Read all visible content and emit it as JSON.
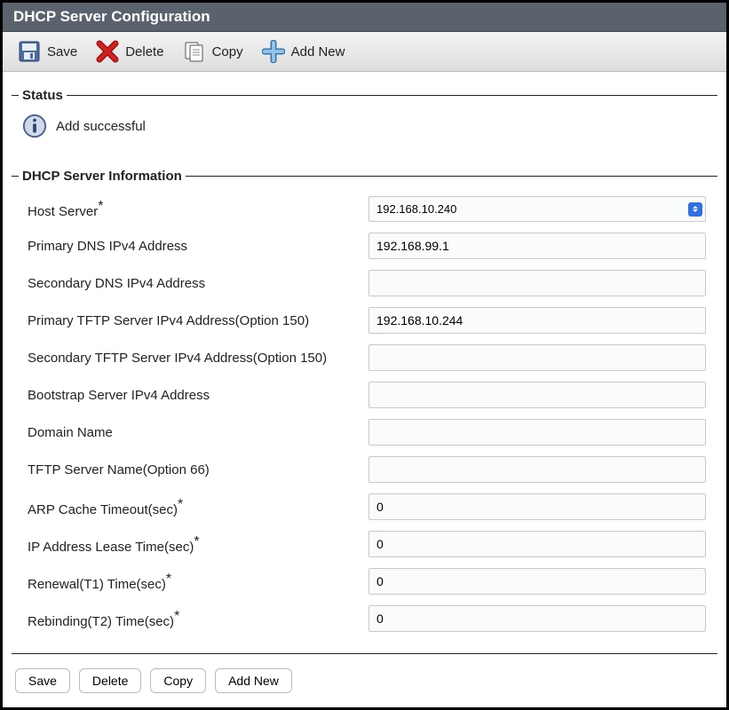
{
  "title": "DHCP Server Configuration",
  "toolbar": {
    "save": "Save",
    "delete": "Delete",
    "copy": "Copy",
    "addnew": "Add New"
  },
  "status": {
    "legend": "Status",
    "message": "Add successful"
  },
  "info": {
    "legend": "DHCP Server Information",
    "fields": {
      "host_server": {
        "label": "Host Server",
        "required": true,
        "value": "192.168.10.240",
        "type": "select"
      },
      "primary_dns": {
        "label": "Primary DNS IPv4 Address",
        "required": false,
        "value": "192.168.99.1",
        "type": "text"
      },
      "secondary_dns": {
        "label": "Secondary DNS IPv4 Address",
        "required": false,
        "value": "",
        "type": "text"
      },
      "primary_tftp": {
        "label": "Primary TFTP Server IPv4 Address(Option 150)",
        "required": false,
        "value": "192.168.10.244",
        "type": "text"
      },
      "secondary_tftp": {
        "label": "Secondary TFTP Server IPv4 Address(Option 150)",
        "required": false,
        "value": "",
        "type": "text"
      },
      "bootstrap": {
        "label": "Bootstrap Server IPv4 Address",
        "required": false,
        "value": "",
        "type": "text"
      },
      "domain_name": {
        "label": "Domain Name",
        "required": false,
        "value": "",
        "type": "text"
      },
      "tftp_name": {
        "label": "TFTP Server Name(Option 66)",
        "required": false,
        "value": "",
        "type": "text"
      },
      "arp_timeout": {
        "label": "ARP Cache Timeout(sec)",
        "required": true,
        "value": "0",
        "type": "text"
      },
      "lease_time": {
        "label": "IP Address Lease Time(sec)",
        "required": true,
        "value": "0",
        "type": "text"
      },
      "renewal_t1": {
        "label": "Renewal(T1) Time(sec)",
        "required": true,
        "value": "0",
        "type": "text"
      },
      "rebinding_t2": {
        "label": "Rebinding(T2) Time(sec)",
        "required": true,
        "value": "0",
        "type": "text"
      }
    },
    "field_order": [
      "host_server",
      "primary_dns",
      "secondary_dns",
      "primary_tftp",
      "secondary_tftp",
      "bootstrap",
      "domain_name",
      "tftp_name",
      "arp_timeout",
      "lease_time",
      "renewal_t1",
      "rebinding_t2"
    ]
  },
  "footer_buttons": {
    "save": "Save",
    "delete": "Delete",
    "copy": "Copy",
    "addnew": "Add New"
  }
}
